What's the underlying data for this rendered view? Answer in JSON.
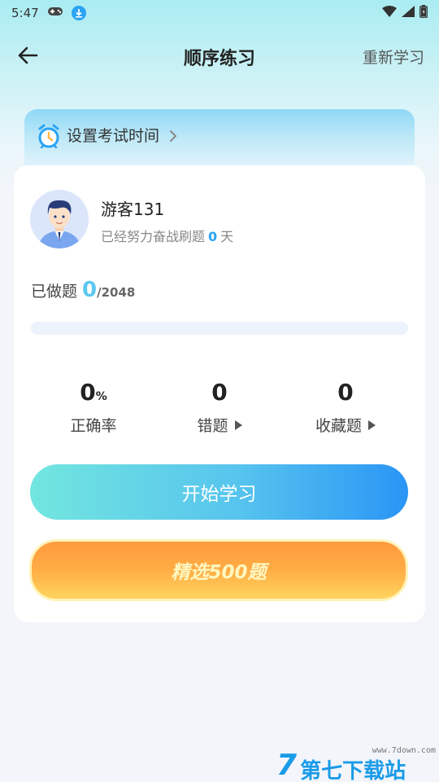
{
  "status_bar": {
    "time": "5:47",
    "icons": [
      "gamepad-icon",
      "download-icon",
      "wifi-icon",
      "signal-icon",
      "battery-icon"
    ]
  },
  "nav": {
    "title": "顺序练习",
    "right_action": "重新学习"
  },
  "exam_banner": {
    "label": "设置考试时间"
  },
  "user": {
    "name": "游客131",
    "subtitle_prefix": "已经努力奋战刷题",
    "days": "0",
    "subtitle_suffix": "天"
  },
  "progress": {
    "label": "已做题",
    "done": "0",
    "total": "/2048",
    "fraction": 0
  },
  "stats": {
    "accuracy_value": "0",
    "accuracy_unit": "%",
    "accuracy_label": "正确率",
    "wrong_value": "0",
    "wrong_label": "错题",
    "favorites_value": "0",
    "favorites_label": "收藏题"
  },
  "buttons": {
    "start": "开始学习",
    "selected": "精选500题"
  },
  "watermark": {
    "logo": "7",
    "text": "第七下载站",
    "url": "www.7down.com"
  },
  "colors": {
    "accent_blue": "#2aa4f4",
    "progress_cyan": "#5cc8f0",
    "start_gradient": [
      "#72e6df",
      "#2a95f5"
    ],
    "orange_gradient": [
      "#ff9a3c",
      "#ffd45e"
    ]
  }
}
